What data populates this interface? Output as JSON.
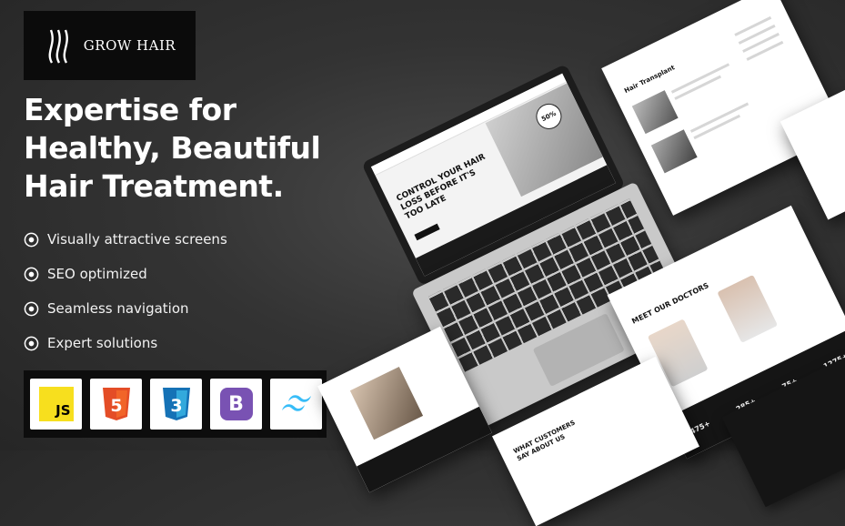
{
  "brand": {
    "name": "GROW HAIR"
  },
  "headline": [
    "Expertise for",
    "Healthy, Beautiful",
    "Hair Treatment."
  ],
  "features": [
    "Visually attractive screens",
    "SEO optimized",
    "Seamless navigation",
    "Expert solutions"
  ],
  "tech_badges": [
    {
      "name": "js-icon",
      "label": "JS",
      "color": "#f7df1e"
    },
    {
      "name": "html5-icon",
      "label": "5",
      "color": "#e44d26"
    },
    {
      "name": "css3-icon",
      "label": "3",
      "color": "#2965f1"
    },
    {
      "name": "bootstrap-icon",
      "label": "B",
      "color": "#7952b3"
    },
    {
      "name": "tailwind-icon",
      "label": "",
      "color": "#38bdf8"
    }
  ],
  "mockups": {
    "hero_text": "CONTROL YOUR HAIR LOSS BEFORE IT'S TOO LATE",
    "doctors_title": "MEET OUR DOCTORS",
    "testimonial_title": "WHAT CUSTOMERS SAY ABOUT US",
    "blog_title": "Hair Transplant",
    "stats": [
      "475+",
      "285+",
      "75+",
      "1275+"
    ],
    "badge": "50%"
  },
  "colors": {
    "background": "#333333",
    "panel": "#0b0b0b",
    "text": "#ffffff"
  }
}
